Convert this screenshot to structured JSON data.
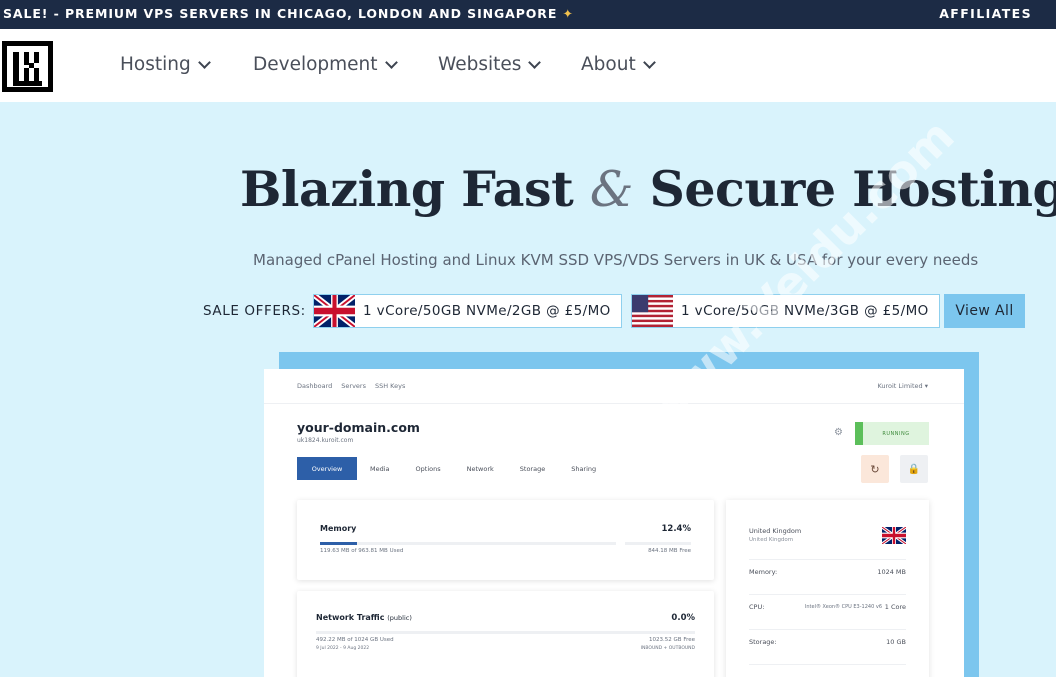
{
  "topbar": {
    "sale_text": "SALE! - PREMIUM VPS SERVERS IN CHICAGO, LONDON AND SINGAPORE",
    "sale_icon": "sparkle-icon",
    "affiliates": "AFFILIATES"
  },
  "nav": {
    "items": [
      {
        "label": "Hosting"
      },
      {
        "label": "Development"
      },
      {
        "label": "Websites"
      },
      {
        "label": "About"
      }
    ]
  },
  "hero": {
    "title_part1": "Blazing Fast",
    "title_amp": "&",
    "title_part2": "Secure Hosting",
    "subtitle": "Managed cPanel Hosting and Linux KVM SSD VPS/VDS Servers in UK & USA for your every needs"
  },
  "offers": {
    "label": "SALE OFFERS:",
    "items": [
      {
        "flag": "uk-flag-icon",
        "text": "1 vCore/50GB NVMe/2GB @ £5/MO"
      },
      {
        "flag": "us-flag-icon",
        "text": "1 vCore/50GB NVMe/3GB @ £5/MO"
      }
    ],
    "view_all": "View All"
  },
  "dashboard": {
    "nav_links": [
      "Dashboard",
      "Servers",
      "SSH Keys"
    ],
    "account": "Kuroit Limited ▾",
    "domain": "your-domain.com",
    "hostname": "uk1824.kuroit.com",
    "status": "RUNNING",
    "tabs": [
      "Overview",
      "Media",
      "Options",
      "Network",
      "Storage",
      "Sharing"
    ],
    "memory": {
      "title": "Memory",
      "percent": "12.4%",
      "usage_fraction": 0.124,
      "used": "119.63 MB of 963.81 MB Used",
      "free": "844.18 MB Free"
    },
    "network": {
      "title": "Network Traffic",
      "title_suffix": "(public)",
      "percent": "0.0%",
      "used": "492.22 MB of 1024 GB Used",
      "period": "9 Jul 2022 - 9 Aug 2022",
      "free": "1023.52 GB Free",
      "direction": "INBOUND + OUTBOUND"
    },
    "server": {
      "location": "United Kingdom",
      "location_sub": "United Kingdom",
      "rows": [
        {
          "key": "Memory:",
          "model": "",
          "value": "1024 MB"
        },
        {
          "key": "CPU:",
          "model": "Intel® Xeon® CPU E3-1240 v6",
          "value": "1 Core"
        },
        {
          "key": "Storage:",
          "model": "",
          "value": "10 GB"
        }
      ]
    }
  },
  "watermark": "www.Veidu.com"
}
